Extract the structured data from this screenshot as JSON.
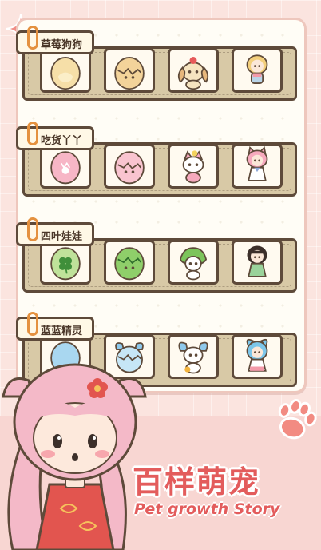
{
  "collection": {
    "rows": [
      {
        "label": "草莓狗狗",
        "pets": [
          "strawberry-dog-egg-icon",
          "strawberry-dog-cracked-egg-icon",
          "strawberry-dog-icon",
          "strawberry-dog-girl-icon"
        ]
      },
      {
        "label": "吃货丫丫",
        "pets": [
          "foodie-egg-icon",
          "foodie-cracked-egg-icon",
          "foodie-cat-icon",
          "foodie-cat-girl-icon"
        ]
      },
      {
        "label": "四叶娃娃",
        "pets": [
          "clover-egg-icon",
          "clover-cracked-egg-icon",
          "clover-sprite-icon",
          "clover-girl-icon"
        ]
      },
      {
        "label": "蓝蓝精灵",
        "pets": [
          "blue-egg-icon",
          "blue-cracked-egg-icon",
          "blue-bunny-icon",
          "blue-bunny-girl-icon"
        ]
      }
    ]
  },
  "promo": {
    "title": "百样萌宠",
    "subtitle": "Pet growth Story"
  },
  "colors": {
    "accent": "#e35c5c",
    "background": "#fbe4df",
    "shelf": "#d8c9a6",
    "outline": "#5e4a3a"
  }
}
